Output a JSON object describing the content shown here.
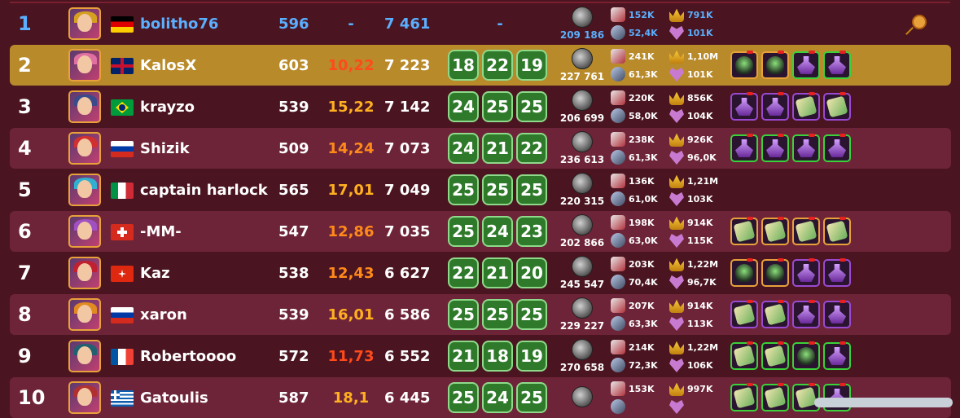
{
  "rows": [
    {
      "rank": "1",
      "name": "bolitho76",
      "flag": "de",
      "level": "596",
      "ratio": "-",
      "points": "7 461",
      "games": [
        "-"
      ],
      "coins": "209 186",
      "atk": "152K",
      "def": "52,4K",
      "ego": "791K",
      "hc": "101K",
      "equip": [],
      "self": true,
      "pin": true
    },
    {
      "rank": "2",
      "name": "KalosX",
      "flag": "gb",
      "level": "603",
      "ratio": "10,22",
      "ratio_color": "red",
      "points": "7 223",
      "games": [
        "18",
        "22",
        "19"
      ],
      "coins": "227 761",
      "atk": "241K",
      "def": "61,3K",
      "ego": "1,10M",
      "hc": "101K",
      "equip": [
        {
          "t": "cauldron",
          "b": "orange"
        },
        {
          "t": "cauldron",
          "b": "orange"
        },
        {
          "t": "potion",
          "b": "green"
        },
        {
          "t": "potion",
          "b": "green"
        }
      ],
      "highlight": true
    },
    {
      "rank": "3",
      "name": "krayzo",
      "flag": "br",
      "level": "539",
      "ratio": "15,22",
      "ratio_color": "yel",
      "points": "7 142",
      "games": [
        "24",
        "25",
        "25"
      ],
      "coins": "206 699",
      "atk": "220K",
      "def": "58,0K",
      "ego": "856K",
      "hc": "104K",
      "equip": [
        {
          "t": "potion",
          "b": "purple"
        },
        {
          "t": "potion",
          "b": "purple"
        },
        {
          "t": "scroll",
          "b": "purple"
        },
        {
          "t": "scroll",
          "b": "purple"
        }
      ]
    },
    {
      "rank": "4",
      "name": "Shizik",
      "flag": "ru",
      "level": "509",
      "ratio": "14,24",
      "ratio_color": "orange",
      "points": "7 073",
      "games": [
        "24",
        "21",
        "22"
      ],
      "coins": "236 613",
      "atk": "238K",
      "def": "61,3K",
      "ego": "926K",
      "hc": "96,0K",
      "equip": [
        {
          "t": "potion",
          "b": "green"
        },
        {
          "t": "potion",
          "b": "green"
        },
        {
          "t": "potion",
          "b": "green"
        },
        {
          "t": "potion",
          "b": "green"
        }
      ]
    },
    {
      "rank": "5",
      "name": "captain harlock",
      "flag": "it",
      "level": "565",
      "ratio": "17,01",
      "ratio_color": "yel",
      "points": "7 049",
      "games": [
        "25",
        "25",
        "25"
      ],
      "coins": "220 315",
      "atk": "136K",
      "def": "61,0K",
      "ego": "1,21M",
      "hc": "103K",
      "equip": []
    },
    {
      "rank": "6",
      "name": "-MM-",
      "flag": "ch",
      "level": "547",
      "ratio": "12,86",
      "ratio_color": "orange",
      "points": "7 035",
      "games": [
        "25",
        "24",
        "23"
      ],
      "coins": "202 866",
      "atk": "198K",
      "def": "63,0K",
      "ego": "914K",
      "hc": "115K",
      "equip": [
        {
          "t": "scroll",
          "b": "orange"
        },
        {
          "t": "scroll",
          "b": "orange"
        },
        {
          "t": "scroll",
          "b": "orange"
        },
        {
          "t": "scroll",
          "b": "orange"
        }
      ]
    },
    {
      "rank": "7",
      "name": "Kaz",
      "flag": "hk",
      "level": "538",
      "ratio": "12,43",
      "ratio_color": "orange",
      "points": "6 627",
      "games": [
        "22",
        "21",
        "20"
      ],
      "coins": "245 547",
      "atk": "203K",
      "def": "70,4K",
      "ego": "1,22M",
      "hc": "96,7K",
      "equip": [
        {
          "t": "cauldron",
          "b": "orange"
        },
        {
          "t": "cauldron",
          "b": "orange"
        },
        {
          "t": "potion",
          "b": "purple"
        },
        {
          "t": "potion",
          "b": "purple"
        }
      ]
    },
    {
      "rank": "8",
      "name": "xaron",
      "flag": "ru",
      "level": "539",
      "ratio": "16,01",
      "ratio_color": "yel",
      "points": "6 586",
      "games": [
        "25",
        "25",
        "25"
      ],
      "coins": "229 227",
      "atk": "207K",
      "def": "63,3K",
      "ego": "914K",
      "hc": "113K",
      "equip": [
        {
          "t": "scroll",
          "b": "purple"
        },
        {
          "t": "scroll",
          "b": "purple"
        },
        {
          "t": "potion",
          "b": "purple"
        },
        {
          "t": "potion",
          "b": "purple"
        }
      ]
    },
    {
      "rank": "9",
      "name": "Robertoooo",
      "flag": "fr",
      "level": "572",
      "ratio": "11,73",
      "ratio_color": "red",
      "points": "6 552",
      "games": [
        "21",
        "18",
        "19"
      ],
      "coins": "270 658",
      "atk": "214K",
      "def": "72,3K",
      "ego": "1,22M",
      "hc": "106K",
      "equip": [
        {
          "t": "scroll",
          "b": "green"
        },
        {
          "t": "scroll",
          "b": "green"
        },
        {
          "t": "cauldron",
          "b": "green"
        },
        {
          "t": "potion",
          "b": "green"
        }
      ]
    },
    {
      "rank": "10",
      "name": "Gatoulis",
      "flag": "gr",
      "level": "587",
      "ratio": "18,1",
      "ratio_color": "yel",
      "points": "6 445",
      "games": [
        "25",
        "24",
        "25"
      ],
      "coins": "",
      "atk": "153K",
      "def": "",
      "ego": "997K",
      "hc": "",
      "equip": [
        {
          "t": "scroll",
          "b": "green"
        },
        {
          "t": "scroll",
          "b": "green"
        },
        {
          "t": "scroll",
          "b": "green"
        },
        {
          "t": "potion",
          "b": "green"
        }
      ]
    }
  ]
}
